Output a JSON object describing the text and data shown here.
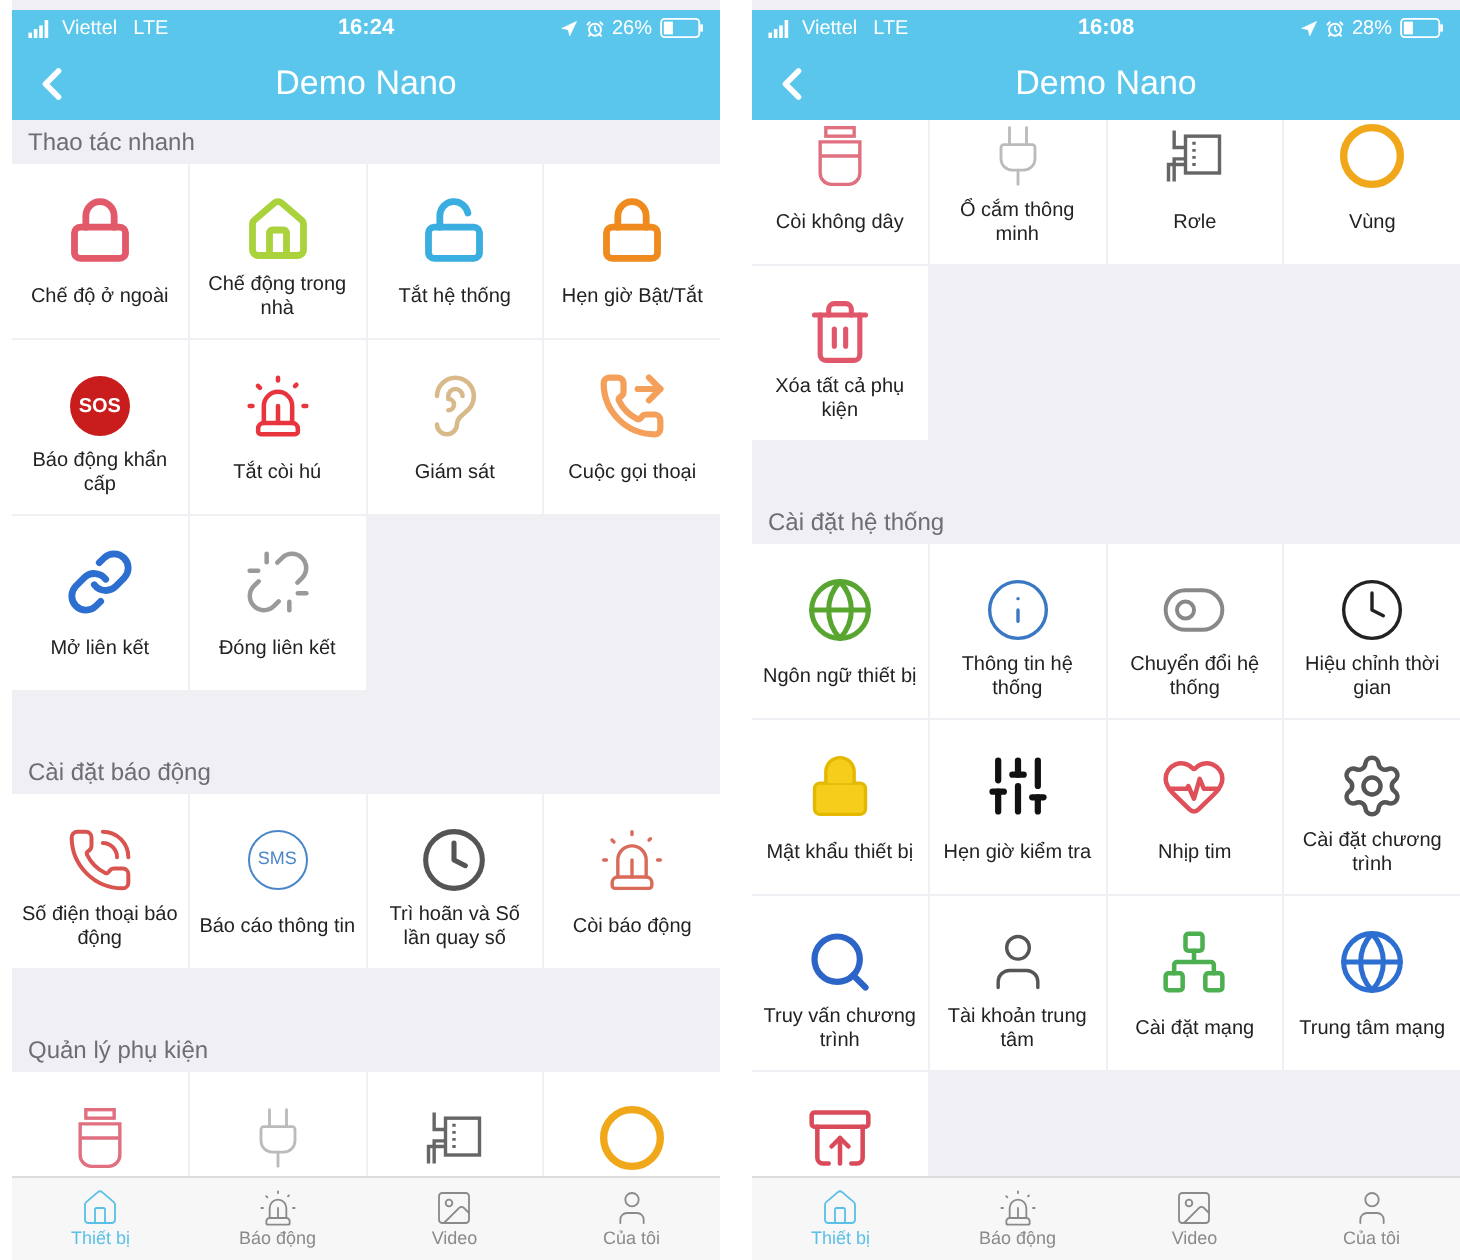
{
  "phones": [
    {
      "status_bar": {
        "carrier": "Viettel",
        "network": "LTE",
        "time": "16:24",
        "battery": "26%"
      },
      "header": {
        "title": "Demo Nano"
      },
      "sections": [
        {
          "title": "Thao tác nhanh",
          "items": [
            {
              "kind": "tile",
              "label": "Chế độ ở ngoài"
            },
            {
              "kind": "tile",
              "label": "Chế động trong nhà"
            },
            {
              "kind": "tile",
              "label": "Tắt hệ thống"
            },
            {
              "kind": "tile",
              "label": "Hẹn giờ Bật/Tắt"
            },
            {
              "kind": "tile",
              "label": "Báo động khẩn cấp",
              "icon_text": "SOS"
            },
            {
              "kind": "tile",
              "label": "Tắt còi hú"
            },
            {
              "kind": "tile",
              "label": "Giám sát"
            },
            {
              "kind": "tile",
              "label": "Cuộc gọi thoại"
            },
            {
              "kind": "tile",
              "label": "Mở liên kết"
            },
            {
              "kind": "tile",
              "label": "Đóng liên kết"
            }
          ]
        },
        {
          "title": "Cài đặt báo động",
          "items": [
            {
              "kind": "tile",
              "label": "Số điện thoại báo động"
            },
            {
              "kind": "tile",
              "label": "Báo cáo thông tin",
              "icon_text": "SMS"
            },
            {
              "kind": "tile",
              "label": "Trì hoãn và Số lần quay số"
            },
            {
              "kind": "tile",
              "label": "Còi báo động"
            }
          ]
        },
        {
          "title": "Quản lý phụ kiện",
          "items": [
            {
              "kind": "cut"
            },
            {
              "kind": "cut"
            },
            {
              "kind": "cut"
            },
            {
              "kind": "cut"
            }
          ]
        }
      ],
      "tab_bar": [
        {
          "label": "Thiết bị",
          "selected": true
        },
        {
          "label": "Báo động",
          "selected": false
        },
        {
          "label": "Video",
          "selected": false
        },
        {
          "label": "Của tôi",
          "selected": false
        }
      ]
    },
    {
      "status_bar": {
        "carrier": "Viettel",
        "network": "LTE",
        "time": "16:08",
        "battery": "28%"
      },
      "header": {
        "title": "Demo Nano"
      },
      "sections": [
        {
          "items": [
            {
              "kind": "tile",
              "label": "Còi không dây"
            },
            {
              "kind": "tile",
              "label": "Ổ cắm thông minh"
            },
            {
              "kind": "tile",
              "label": "Rơle"
            },
            {
              "kind": "tile",
              "label": "Vùng"
            },
            {
              "kind": "tile",
              "label": "Xóa tất cả phụ kiện"
            }
          ]
        },
        {
          "title": "Cài đặt hệ thống",
          "items": [
            {
              "kind": "tile",
              "label": "Ngôn ngữ thiết bị"
            },
            {
              "kind": "tile",
              "label": "Thông tin hệ thống"
            },
            {
              "kind": "tile",
              "label": "Chuyển đổi hệ thống"
            },
            {
              "kind": "tile",
              "label": "Hiệu chỉnh thời gian"
            },
            {
              "kind": "tile",
              "label": "Mật khẩu thiết bị"
            },
            {
              "kind": "tile",
              "label": "Hẹn giờ kiểm tra"
            },
            {
              "kind": "tile",
              "label": "Nhịp tim"
            },
            {
              "kind": "tile",
              "label": "Cài đặt chương trình"
            },
            {
              "kind": "tile",
              "label": "Truy vấn chương trình"
            },
            {
              "kind": "tile",
              "label": "Tài khoản trung tâm"
            },
            {
              "kind": "tile",
              "label": "Cài đặt mạng"
            },
            {
              "kind": "tile",
              "label": "Trung tâm mạng"
            },
            {
              "kind": "cut"
            }
          ]
        }
      ],
      "tab_bar": [
        {
          "label": "Thiết bị",
          "selected": true
        },
        {
          "label": "Báo động",
          "selected": false
        },
        {
          "label": "Video",
          "selected": false
        },
        {
          "label": "Của tôi",
          "selected": false
        }
      ]
    }
  ]
}
